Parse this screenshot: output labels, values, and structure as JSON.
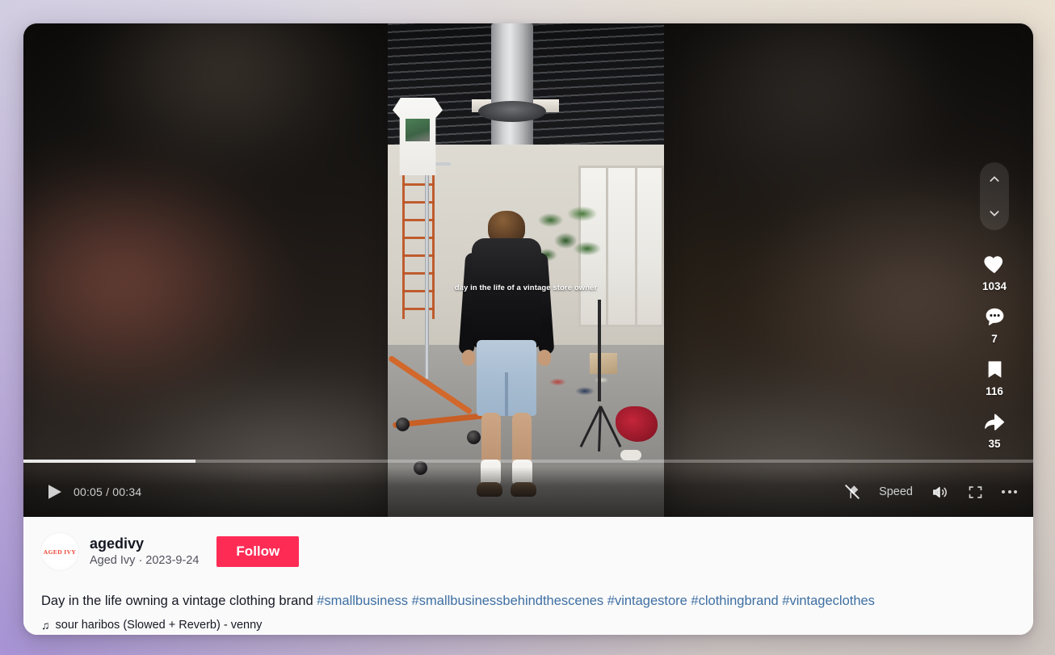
{
  "video": {
    "overlay_text": "day in the life of a vintage store owner",
    "current_time": "00:05",
    "duration": "00:34",
    "time_display": "00:05 / 00:34",
    "progress_percent": 17,
    "play_icon": "play-icon"
  },
  "rail": {
    "nav_up_icon": "chevron-up-icon",
    "nav_down_icon": "chevron-down-icon",
    "actions": [
      {
        "icon": "heart-icon",
        "name": "like",
        "count": "1034"
      },
      {
        "icon": "comment-icon",
        "name": "comment",
        "count": "7"
      },
      {
        "icon": "bookmark-icon",
        "name": "bookmark",
        "count": "116"
      },
      {
        "icon": "share-icon",
        "name": "share",
        "count": "35"
      }
    ]
  },
  "controls": {
    "clear_mode_icon": "clear-mode-off-icon",
    "speed_label": "Speed",
    "volume_icon": "volume-on-icon",
    "fullscreen_icon": "fullscreen-icon",
    "more_icon": "more-options-icon"
  },
  "author": {
    "avatar_text": "AGED IVY",
    "username": "agedivy",
    "display_name": "Aged Ivy",
    "date": "2023-9-24",
    "separator": "·",
    "sub_line": "Aged Ivy · 2023-9-24",
    "follow_label": "Follow"
  },
  "post": {
    "caption_text": "Day in the life owning a vintage clothing brand",
    "hashtags": [
      "#smallbusiness",
      "#smallbusinessbehindthescenes",
      "#vintagestore",
      "#clothingbrand",
      "#vintageclothes"
    ],
    "music_note": "♫",
    "music_title": "sour haribos (Slowed + Reverb) - venny"
  },
  "colors": {
    "brand_red": "#fe2c55",
    "hashtag_blue": "#3e6fa3",
    "text_primary": "#161823",
    "card_bg": "#fafafa"
  }
}
